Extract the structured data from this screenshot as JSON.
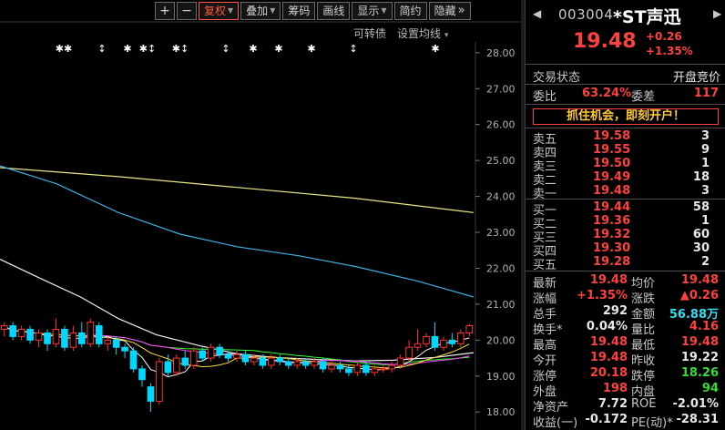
{
  "toolbar": {
    "zoom_in": "+",
    "zoom_out": "−",
    "buttons": [
      {
        "label": "复权",
        "active": true,
        "caret": true
      },
      {
        "label": "叠加",
        "active": false,
        "caret": true
      },
      {
        "label": "筹码",
        "active": false,
        "caret": false
      },
      {
        "label": "画线",
        "active": false,
        "caret": false
      },
      {
        "label": "显示",
        "active": false,
        "caret": true
      },
      {
        "label": "简约",
        "active": false,
        "caret": false
      },
      {
        "label": "隐藏",
        "active": false,
        "caret": false
      }
    ],
    "more_icon": "»"
  },
  "sub_toolbar": {
    "convertible": "可转债",
    "ma_settings": "设置均线",
    "caret": "▾"
  },
  "chart_data": {
    "type": "candlestick",
    "y_ticks": [
      "28.00",
      "27.00",
      "26.00",
      "25.00",
      "24.00",
      "23.00",
      "22.00",
      "21.00",
      "20.00",
      "19.00",
      "18.00"
    ],
    "ylim": [
      17.6,
      28.3
    ],
    "event_markers": [
      "✱✱",
      "↕",
      "✱",
      "✱↕",
      "✱↕",
      "↕",
      "✱",
      "✱",
      "✱",
      "↕",
      "✱"
    ],
    "colors": {
      "up": "#ff3232",
      "down": "#00d8ff",
      "ma_long": "#e8e68a",
      "ma_mid": "#3fb0e0",
      "ma_short": "#f0f0f0",
      "ma5": "#ffffff",
      "ma10": "#ffdc32",
      "ma20": "#ff40ff",
      "ma30": "#33ff33"
    },
    "ma_long": [
      [
        0,
        24.8
      ],
      [
        0.25,
        24.55
      ],
      [
        0.5,
        24.25
      ],
      [
        0.75,
        23.95
      ],
      [
        1,
        23.55
      ]
    ],
    "ma_mid": [
      [
        0,
        24.85
      ],
      [
        0.12,
        24.35
      ],
      [
        0.25,
        23.55
      ],
      [
        0.38,
        22.95
      ],
      [
        0.5,
        22.6
      ],
      [
        0.63,
        22.35
      ],
      [
        0.75,
        22.05
      ],
      [
        0.88,
        21.65
      ],
      [
        1,
        21.2
      ]
    ],
    "ma_short": [
      [
        0,
        22.25
      ],
      [
        0.08,
        21.75
      ],
      [
        0.17,
        21.2
      ],
      [
        0.25,
        20.6
      ],
      [
        0.33,
        20.15
      ],
      [
        0.42,
        19.85
      ],
      [
        0.5,
        19.62
      ],
      [
        0.58,
        19.52
      ],
      [
        0.67,
        19.46
      ],
      [
        0.75,
        19.42
      ],
      [
        0.83,
        19.44
      ],
      [
        0.92,
        19.52
      ],
      [
        1,
        19.65
      ]
    ],
    "candles": [
      [
        20.3,
        20.4,
        20.1,
        20.5
      ],
      [
        20.4,
        20.1,
        20.0,
        20.5
      ],
      [
        20.1,
        20.3,
        20.0,
        20.4
      ],
      [
        20.3,
        20.0,
        19.9,
        20.4
      ],
      [
        20.0,
        20.2,
        19.8,
        20.3
      ],
      [
        20.2,
        19.9,
        19.7,
        20.3
      ],
      [
        19.9,
        20.3,
        19.8,
        20.6
      ],
      [
        20.3,
        19.8,
        19.7,
        20.4
      ],
      [
        19.8,
        20.2,
        19.7,
        20.4
      ],
      [
        20.2,
        19.9,
        19.8,
        20.5
      ],
      [
        19.9,
        20.5,
        19.8,
        20.6
      ],
      [
        20.4,
        19.9,
        19.8,
        20.5
      ],
      [
        19.9,
        20.0,
        19.7,
        20.1
      ],
      [
        20.0,
        19.8,
        19.6,
        20.1
      ],
      [
        19.8,
        19.7,
        19.5,
        19.9
      ],
      [
        19.7,
        19.2,
        19.1,
        19.8
      ],
      [
        19.2,
        18.9,
        18.7,
        19.3
      ],
      [
        18.7,
        18.3,
        18.0,
        18.8
      ],
      [
        18.3,
        19.4,
        18.2,
        19.5
      ],
      [
        19.4,
        19.1,
        19.0,
        19.6
      ],
      [
        19.1,
        19.5,
        19.0,
        19.6
      ],
      [
        19.5,
        19.3,
        19.2,
        19.7
      ],
      [
        19.3,
        19.7,
        19.2,
        19.8
      ],
      [
        19.7,
        19.5,
        19.4,
        19.8
      ],
      [
        19.5,
        19.8,
        19.4,
        19.9
      ],
      [
        19.8,
        19.6,
        19.5,
        19.9
      ],
      [
        19.6,
        19.5,
        19.4,
        19.7
      ],
      [
        19.5,
        19.6,
        19.4,
        19.7
      ],
      [
        19.6,
        19.4,
        19.3,
        19.7
      ],
      [
        19.4,
        19.5,
        19.3,
        19.6
      ],
      [
        19.5,
        19.3,
        19.2,
        19.6
      ],
      [
        19.3,
        19.5,
        19.2,
        19.6
      ],
      [
        19.5,
        19.4,
        19.3,
        19.6
      ],
      [
        19.4,
        19.3,
        19.2,
        19.5
      ],
      [
        19.3,
        19.4,
        19.2,
        19.5
      ],
      [
        19.4,
        19.3,
        19.2,
        19.5
      ],
      [
        19.3,
        19.4,
        19.2,
        19.5
      ],
      [
        19.4,
        19.2,
        19.1,
        19.5
      ],
      [
        19.2,
        19.3,
        19.1,
        19.4
      ],
      [
        19.3,
        19.2,
        19.1,
        19.4
      ],
      [
        19.2,
        19.1,
        19.0,
        19.3
      ],
      [
        19.1,
        19.3,
        19.0,
        19.4
      ],
      [
        19.3,
        19.1,
        19.0,
        19.4
      ],
      [
        19.1,
        19.2,
        19.0,
        19.3
      ],
      [
        19.2,
        19.2,
        19.1,
        19.3
      ],
      [
        19.2,
        19.3,
        19.1,
        19.4
      ],
      [
        19.3,
        19.5,
        19.2,
        19.6
      ],
      [
        19.5,
        19.8,
        19.4,
        20.0
      ],
      [
        19.8,
        19.9,
        19.7,
        20.3
      ],
      [
        19.9,
        20.1,
        19.8,
        20.2
      ],
      [
        20.1,
        19.8,
        19.7,
        20.5
      ],
      [
        19.8,
        20.0,
        19.7,
        20.1
      ],
      [
        20.0,
        19.9,
        19.8,
        20.2
      ],
      [
        19.9,
        20.2,
        19.8,
        20.3
      ],
      [
        20.2,
        20.4,
        20.1,
        20.45
      ]
    ]
  },
  "stock": {
    "prev_arrow": "◀",
    "next_arrow": "▶",
    "code": "003004",
    "name": "*ST声迅",
    "price": "19.48",
    "change": "+0.26",
    "change_pct": "+1.35%"
  },
  "status": {
    "label": "交易状态",
    "value": "开盘竞价"
  },
  "ratio": {
    "label1": "委比",
    "value1": "63.24%",
    "label2": "委差",
    "value2": "117"
  },
  "promo": "抓住机会，即刻开户！",
  "sells": [
    {
      "label": "卖五",
      "price": "19.58",
      "vol": "3"
    },
    {
      "label": "卖四",
      "price": "19.55",
      "vol": "9"
    },
    {
      "label": "卖三",
      "price": "19.50",
      "vol": "1"
    },
    {
      "label": "卖二",
      "price": "19.49",
      "vol": "18"
    },
    {
      "label": "卖一",
      "price": "19.48",
      "vol": "3"
    }
  ],
  "buys": [
    {
      "label": "买一",
      "price": "19.44",
      "vol": "58"
    },
    {
      "label": "买二",
      "price": "19.36",
      "vol": "1"
    },
    {
      "label": "买三",
      "price": "19.32",
      "vol": "60"
    },
    {
      "label": "买四",
      "price": "19.30",
      "vol": "30"
    },
    {
      "label": "买五",
      "price": "19.28",
      "vol": "2"
    }
  ],
  "quotes": [
    {
      "l1": "最新",
      "v1": "19.48",
      "c1": "red",
      "l2": "均价",
      "v2": "19.48",
      "c2": "red"
    },
    {
      "l1": "涨幅",
      "v1": "+1.35%",
      "c1": "red",
      "l2": "涨跌",
      "v2": "▲0.26",
      "c2": "red"
    },
    {
      "l1": "总手",
      "v1": "292",
      "c1": "white",
      "l2": "金额",
      "v2": "56.88万",
      "c2": "cyan"
    },
    {
      "l1": "换手*",
      "v1": "0.04%",
      "c1": "white",
      "l2": "量比",
      "v2": "4.16",
      "c2": "red"
    },
    {
      "l1": "最高",
      "v1": "19.48",
      "c1": "red",
      "l2": "最低",
      "v2": "19.48",
      "c2": "red"
    },
    {
      "l1": "今开",
      "v1": "19.48",
      "c1": "red",
      "l2": "昨收",
      "v2": "19.22",
      "c2": "white"
    },
    {
      "l1": "涨停",
      "v1": "20.18",
      "c1": "red",
      "l2": "跌停",
      "v2": "18.26",
      "c2": "green"
    },
    {
      "l1": "外盘",
      "v1": "198",
      "c1": "red",
      "l2": "内盘",
      "v2": "94",
      "c2": "green"
    },
    {
      "l1": "净资产",
      "v1": "7.72",
      "c1": "white",
      "l2": "ROE",
      "v2": "-2.01%",
      "c2": "white"
    },
    {
      "l1": "收益(一)",
      "v1": "-0.172",
      "c1": "white",
      "l2": "PE(动)*",
      "v2": "-28.31",
      "c2": "white"
    }
  ]
}
